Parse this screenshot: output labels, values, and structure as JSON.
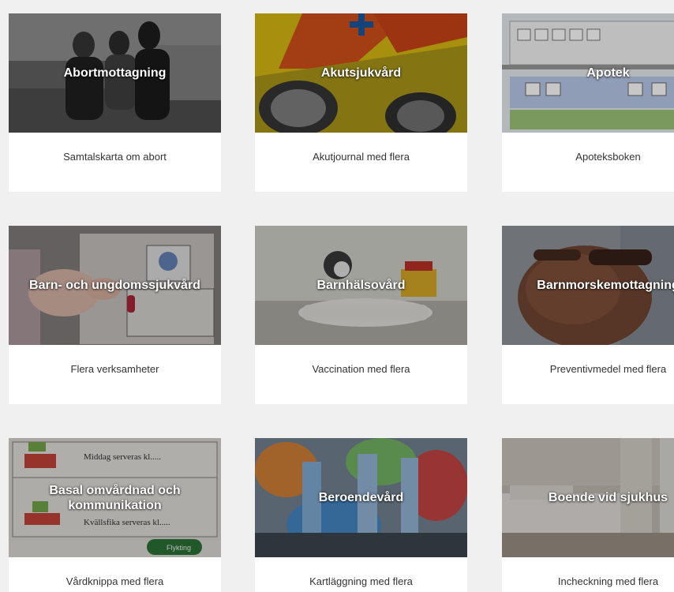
{
  "cards": [
    {
      "title": "Abortmottagning",
      "subtitle": "Samtalskarta om abort",
      "image": "girls-walking-photo"
    },
    {
      "title": "Akutsjukvård",
      "subtitle": "Akutjournal med flera",
      "image": "ambulance-photo"
    },
    {
      "title": "Apotek",
      "subtitle": "Apoteksboken",
      "image": "symbol-chart-photo"
    },
    {
      "title": "Barn- och ungdomssjukvård",
      "subtitle": "Flera verksamheter",
      "image": "child-hand-pictogram-photo"
    },
    {
      "title": "Barnhälsovård",
      "subtitle": "Vaccination med flera",
      "image": "baby-scale-photo"
    },
    {
      "title": "Barnmorskemottagning",
      "subtitle": "Preventivmedel med flera",
      "image": "pregnant-belly-photo"
    },
    {
      "title": "Basal omvårdnad och\nkommunikation",
      "subtitle": "Vårdknippa med flera",
      "image": "meal-schedule-card-photo",
      "card_texts": [
        "Middag serveras kl.....",
        "Kvällsfika serveras kl.....",
        "Flykting"
      ]
    },
    {
      "title": "Beroendevård",
      "subtitle": "Kartläggning med flera",
      "image": "graffiti-wall-photo"
    },
    {
      "title": "Boende vid sjukhus",
      "subtitle": "Incheckning med flera",
      "image": "hotel-bedroom-photo"
    }
  ]
}
